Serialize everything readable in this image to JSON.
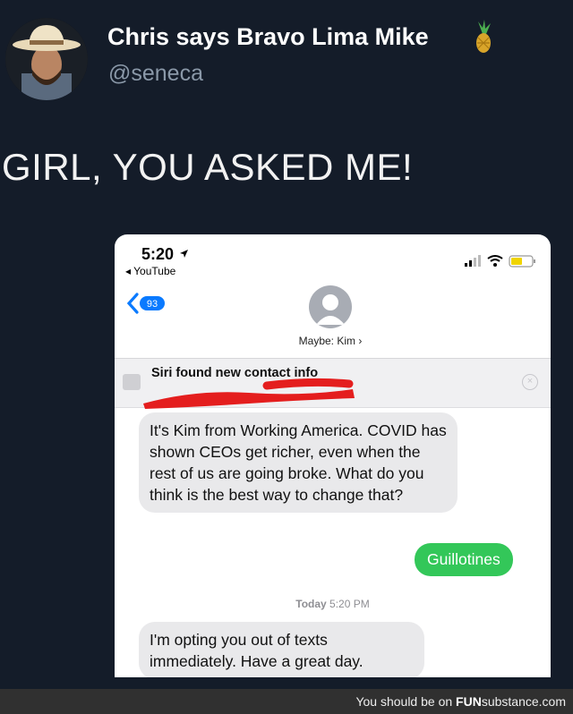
{
  "tweet": {
    "display_name": "Chris says Bravo Lima Mike",
    "name_emoji": "pineapple-icon",
    "handle": "@seneca",
    "text": "GIRL, YOU ASKED ME!"
  },
  "phone": {
    "status_time": "5:20",
    "status_back_app": "◂ YouTube",
    "unread_count": "93",
    "contact_name": "Maybe: Kim ›",
    "siri_banner_text": "Siri found new contact info",
    "messages": [
      {
        "direction": "incoming",
        "text": "It's Kim from Working America. COVID has shown CEOs get richer, even when the rest of us are going broke. What do you think is the best way to change that?"
      },
      {
        "direction": "outgoing",
        "text": "Guillotines"
      },
      {
        "direction": "incoming",
        "text": "I'm opting you out of texts immediately. Have a great day."
      }
    ],
    "timestamp_day": "Today",
    "timestamp_time": "5:20 PM",
    "colors": {
      "outgoing": "#33c759",
      "incoming": "#e9e9eb",
      "link_blue": "#0a7aff"
    }
  },
  "footer": {
    "prefix": "You should be on ",
    "brand_bold": "FUN",
    "brand_rest": "substance.com"
  }
}
